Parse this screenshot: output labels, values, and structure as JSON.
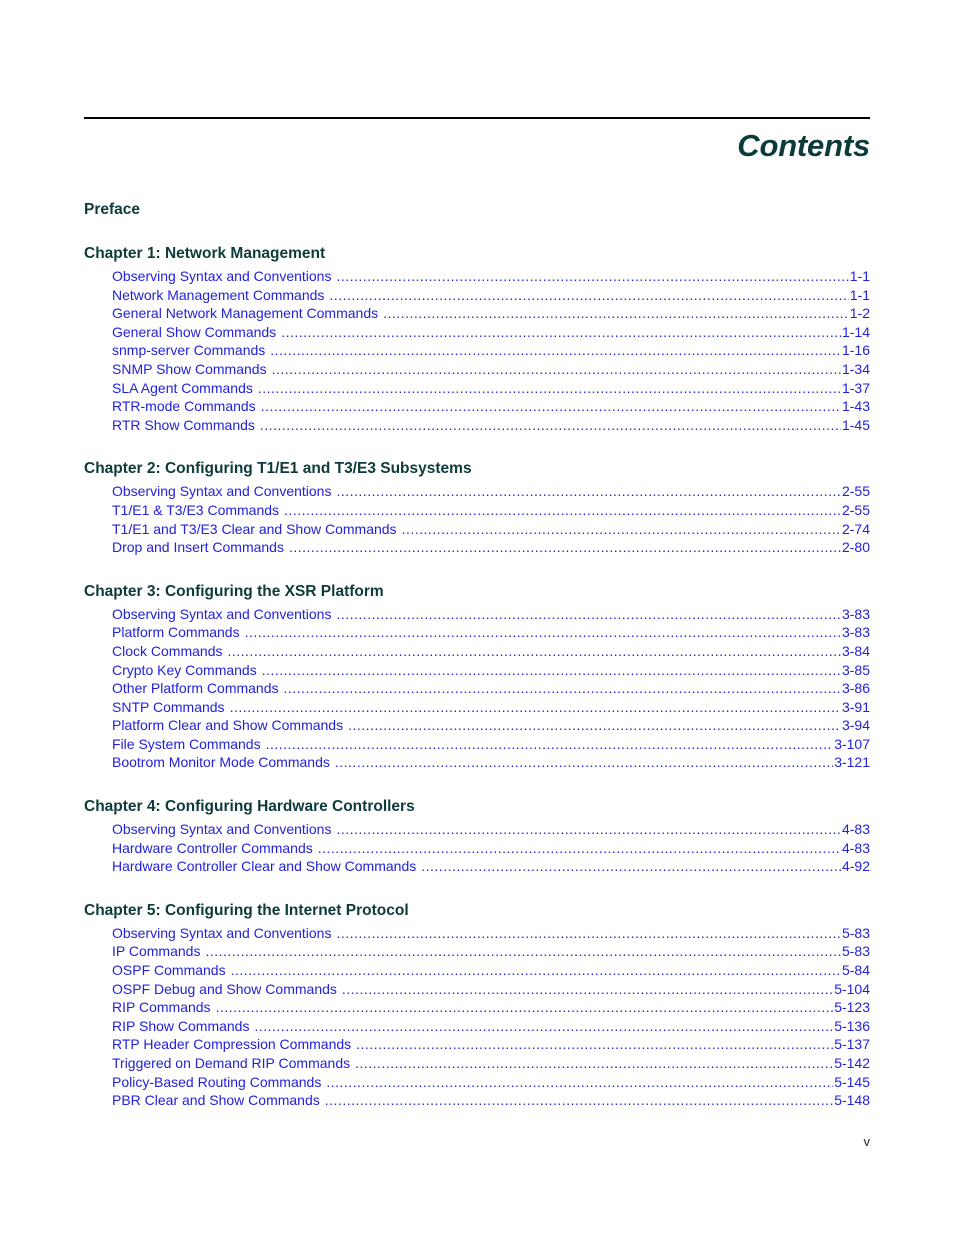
{
  "page": {
    "title": "Contents",
    "footer_page_number": "v"
  },
  "preface": {
    "label": "Preface"
  },
  "chapters": [
    {
      "heading": "Chapter 1: Network Management",
      "entries": [
        {
          "label": "Observing Syntax and Conventions",
          "page": "1-1"
        },
        {
          "label": "Network Management Commands",
          "page": "1-1"
        },
        {
          "label": "General Network Management Commands",
          "page": "1-2"
        },
        {
          "label": "General Show Commands",
          "page": "1-14"
        },
        {
          "label": "snmp-server Commands",
          "page": "1-16"
        },
        {
          "label": "SNMP Show Commands",
          "page": "1-34"
        },
        {
          "label": "SLA Agent Commands",
          "page": "1-37"
        },
        {
          "label": "RTR-mode Commands",
          "page": "1-43"
        },
        {
          "label": "RTR Show Commands",
          "page": "1-45"
        }
      ]
    },
    {
      "heading": "Chapter 2: Configuring T1/E1 and T3/E3 Subsystems",
      "entries": [
        {
          "label": "Observing Syntax and Conventions",
          "page": "2-55"
        },
        {
          "label": "T1/E1 & T3/E3 Commands",
          "page": "2-55"
        },
        {
          "label": "T1/E1 and T3/E3 Clear and Show Commands",
          "page": "2-74"
        },
        {
          "label": "Drop and Insert Commands",
          "page": "2-80"
        }
      ]
    },
    {
      "heading": "Chapter 3: Configuring the XSR Platform",
      "entries": [
        {
          "label": "Observing Syntax and Conventions",
          "page": "3-83"
        },
        {
          "label": "Platform Commands",
          "page": "3-83"
        },
        {
          "label": "Clock Commands",
          "page": "3-84"
        },
        {
          "label": "Crypto Key Commands",
          "page": "3-85"
        },
        {
          "label": "Other Platform Commands",
          "page": "3-86"
        },
        {
          "label": "SNTP Commands",
          "page": "3-91"
        },
        {
          "label": "Platform Clear and Show Commands",
          "page": "3-94"
        },
        {
          "label": "File System Commands",
          "page": "3-107"
        },
        {
          "label": "Bootrom Monitor Mode Commands",
          "page": "3-121"
        }
      ]
    },
    {
      "heading": "Chapter 4: Configuring Hardware Controllers",
      "entries": [
        {
          "label": "Observing Syntax and Conventions",
          "page": "4-83"
        },
        {
          "label": "Hardware Controller Commands",
          "page": "4-83"
        },
        {
          "label": "Hardware Controller Clear and Show Commands",
          "page": "4-92"
        }
      ]
    },
    {
      "heading": "Chapter 5: Configuring the Internet Protocol",
      "entries": [
        {
          "label": "Observing Syntax and Conventions",
          "page": "5-83"
        },
        {
          "label": "IP Commands",
          "page": "5-83"
        },
        {
          "label": "OSPF Commands",
          "page": "5-84"
        },
        {
          "label": "OSPF Debug and Show Commands",
          "page": "5-104"
        },
        {
          "label": "RIP Commands",
          "page": "5-123"
        },
        {
          "label": "RIP Show Commands",
          "page": "5-136"
        },
        {
          "label": "RTP Header Compression Commands",
          "page": "5-137"
        },
        {
          "label": "Triggered on Demand RIP Commands",
          "page": "5-142"
        },
        {
          "label": "Policy-Based Routing Commands",
          "page": "5-145"
        },
        {
          "label": "PBR Clear and Show Commands",
          "page": "5-148"
        }
      ]
    }
  ],
  "colors": {
    "heading": "#0d3b39",
    "link": "#2222dd",
    "rule": "#000000",
    "footer": "#231f20"
  }
}
